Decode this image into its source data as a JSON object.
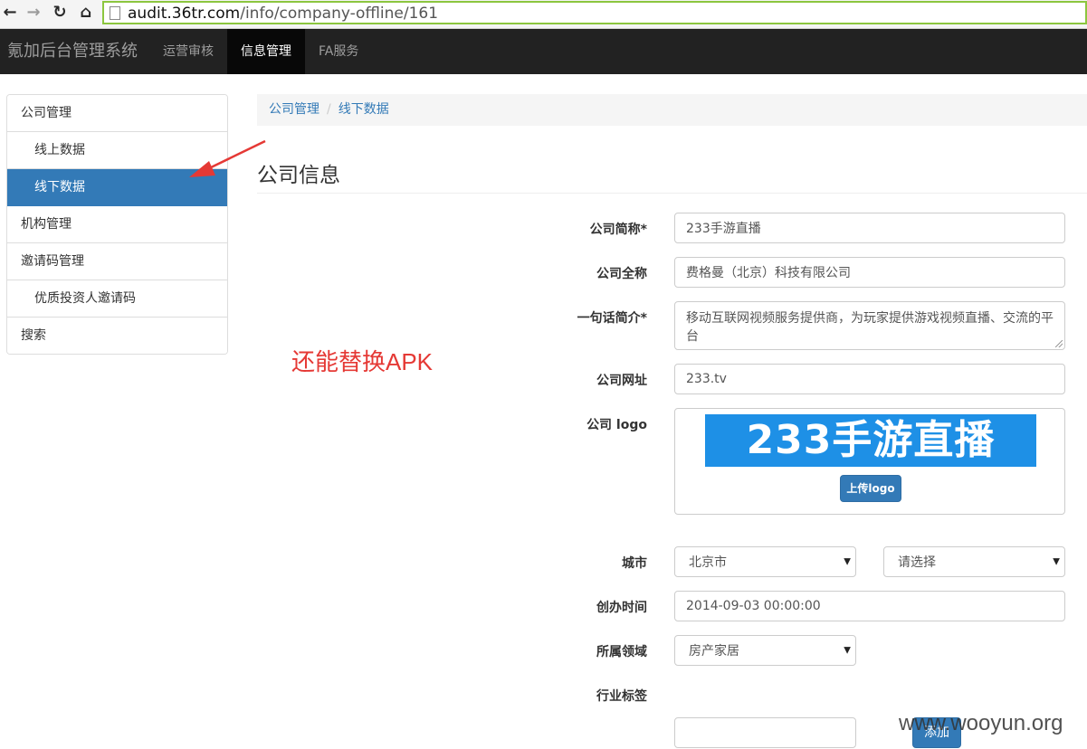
{
  "browser": {
    "url_host": "audit.36tr.com",
    "url_path": "/info/company-offline/161"
  },
  "topnav": {
    "brand": "氪加后台管理系统",
    "items": [
      {
        "label": "运营审核",
        "active": false
      },
      {
        "label": "信息管理",
        "active": true
      },
      {
        "label": "FA服务",
        "active": false
      }
    ]
  },
  "sidebar": {
    "items": [
      {
        "label": "公司管理"
      },
      {
        "label": "线上数据"
      },
      {
        "label": "线下数据"
      },
      {
        "label": "机构管理"
      },
      {
        "label": "邀请码管理"
      },
      {
        "label": "优质投资人邀请码"
      },
      {
        "label": "搜索"
      }
    ]
  },
  "annotation": "还能替换APK",
  "breadcrumb": {
    "items": [
      "公司管理",
      "线下数据"
    ],
    "separator": "/"
  },
  "page_title": "公司信息",
  "form": {
    "short_name": {
      "label": "公司简称*",
      "value": "233手游直播"
    },
    "full_name": {
      "label": "公司全称",
      "value": "费格曼（北京）科技有限公司"
    },
    "intro": {
      "label": "一句话简介*",
      "value": "移动互联网视频服务提供商，为玩家提供游戏视频直播、交流的平台"
    },
    "website": {
      "label": "公司网址",
      "value": "233.tv"
    },
    "logo": {
      "label": "公司 logo",
      "image_text": "233手游直播",
      "upload_label": "上传logo"
    },
    "city": {
      "label": "城市",
      "selected": "北京市",
      "district_selected": "请选择"
    },
    "founded": {
      "label": "创办时间",
      "value": "2014-09-03 00:00:00"
    },
    "domain": {
      "label": "所属领域",
      "selected": "房产家居"
    },
    "tags": {
      "label": "行业标签",
      "input_value": "",
      "add_label": "添加"
    }
  },
  "watermark": "www.wooyun.org",
  "colors": {
    "primary": "#337ab7",
    "navbar": "#222222",
    "annotation": "#e53935",
    "urlbar_border": "#8cc63f"
  }
}
